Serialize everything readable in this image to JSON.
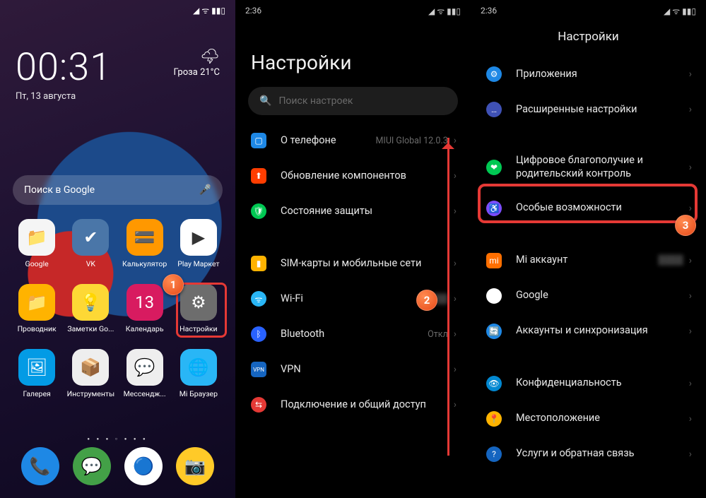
{
  "panel1": {
    "time": "00:31",
    "date": "Пт, 13 августа",
    "weather_label": "Гроза",
    "weather_temp": "21°C",
    "search_placeholder": "Поиск в Google",
    "apps_row1": [
      {
        "label": "Google",
        "bg": "#f5f5f5",
        "glyph": "📁"
      },
      {
        "label": "VK",
        "bg": "#4a76a8",
        "glyph": "✔"
      },
      {
        "label": "Калькулятор",
        "bg": "#ff9800",
        "glyph": "🟰"
      },
      {
        "label": "Play Маркет",
        "bg": "#ffffff",
        "glyph": "▶"
      }
    ],
    "apps_row2": [
      {
        "label": "Проводник",
        "bg": "#ffb300",
        "glyph": "📁"
      },
      {
        "label": "Заметки Go...",
        "bg": "#fdd835",
        "glyph": "💡"
      },
      {
        "label": "Календарь",
        "bg": "#d81b60",
        "glyph": "13"
      },
      {
        "label": "Настройки",
        "bg": "#6d6d6d",
        "glyph": "⚙"
      }
    ],
    "apps_row3": [
      {
        "label": "Галерея",
        "bg": "#039be5",
        "glyph": "🖼"
      },
      {
        "label": "Инструменты",
        "bg": "#eeeeee",
        "glyph": "📦"
      },
      {
        "label": "Мессендж...",
        "bg": "#eeeeee",
        "glyph": "💬"
      },
      {
        "label": "Mi Браузер",
        "bg": "#29b6f6",
        "glyph": "🌐"
      }
    ],
    "dock": [
      {
        "bg": "#1e88e5",
        "glyph": "📞"
      },
      {
        "bg": "#43a047",
        "glyph": "💬"
      },
      {
        "bg": "#ffffff",
        "glyph": "🔵"
      },
      {
        "bg": "#ffca28",
        "glyph": "📷"
      }
    ]
  },
  "panel2": {
    "status_time": "2:36",
    "title": "Настройки",
    "search_placeholder": "Поиск настроек",
    "items": [
      {
        "icon_bg": "#1e88e5",
        "icon_shape": "sq",
        "glyph": "▢",
        "label": "О телефоне",
        "value": "MIUI Global 12.0.3"
      },
      {
        "icon_bg": "#ff3d00",
        "icon_shape": "sq",
        "glyph": "⬆",
        "label": "Обновление компонентов"
      },
      {
        "icon_bg": "#00c853",
        "icon_shape": "rd",
        "glyph": "🛡",
        "label": "Состояние защиты"
      },
      {
        "gap": true
      },
      {
        "icon_bg": "#ffb300",
        "icon_shape": "sq",
        "glyph": "▮",
        "label": "SIM-карты и мобильные сети"
      },
      {
        "icon_bg": "#29b6f6",
        "icon_shape": "rd",
        "glyph": "ᯤ",
        "label": "Wi-Fi",
        "value": " "
      },
      {
        "icon_bg": "#2962ff",
        "icon_shape": "rd",
        "glyph": "ᛒ",
        "label": "Bluetooth",
        "value": "Откл"
      },
      {
        "icon_bg": "#1565c0",
        "icon_shape": "sq",
        "glyph": "VPN",
        "label": "VPN"
      },
      {
        "icon_bg": "#e53935",
        "icon_shape": "rd",
        "glyph": "⇆",
        "label": "Подключение и общий доступ"
      }
    ]
  },
  "panel3": {
    "status_time": "2:36",
    "title": "Настройки",
    "items": [
      {
        "icon_bg": "#1e88e5",
        "icon_shape": "rd",
        "glyph": "⚙",
        "label": "Приложения"
      },
      {
        "icon_bg": "#3f51b5",
        "icon_shape": "rd",
        "glyph": "…",
        "label": "Расширенные настройки"
      },
      {
        "gap": true
      },
      {
        "icon_bg": "#00c853",
        "icon_shape": "rd",
        "glyph": "❤",
        "label": "Цифровое благополучие и родительский контроль"
      },
      {
        "icon_bg": "#7c4dff",
        "icon_shape": "rd",
        "glyph": "♿",
        "label": "Особые возможности",
        "highlight": true
      },
      {
        "gap": true
      },
      {
        "icon_bg": "#ff6f00",
        "icon_shape": "sq",
        "glyph": "mi",
        "label": "Mi аккаунт",
        "value": " "
      },
      {
        "icon_bg": "#ffffff",
        "icon_shape": "rd",
        "glyph": "G",
        "label": "Google"
      },
      {
        "icon_bg": "#1e88e5",
        "icon_shape": "rd",
        "glyph": "🔄",
        "label": "Аккаунты и синхронизация"
      },
      {
        "gap": true
      },
      {
        "icon_bg": "#0288d1",
        "icon_shape": "rd",
        "glyph": "👁",
        "label": "Конфиденциальность"
      },
      {
        "icon_bg": "#ffb300",
        "icon_shape": "rd",
        "glyph": "📍",
        "label": "Местоположение"
      },
      {
        "icon_bg": "#1565c0",
        "icon_shape": "rd",
        "glyph": "?",
        "label": "Услуги и обратная связь"
      }
    ]
  },
  "annotations": {
    "b1": "1",
    "b2": "2",
    "b3": "3"
  }
}
